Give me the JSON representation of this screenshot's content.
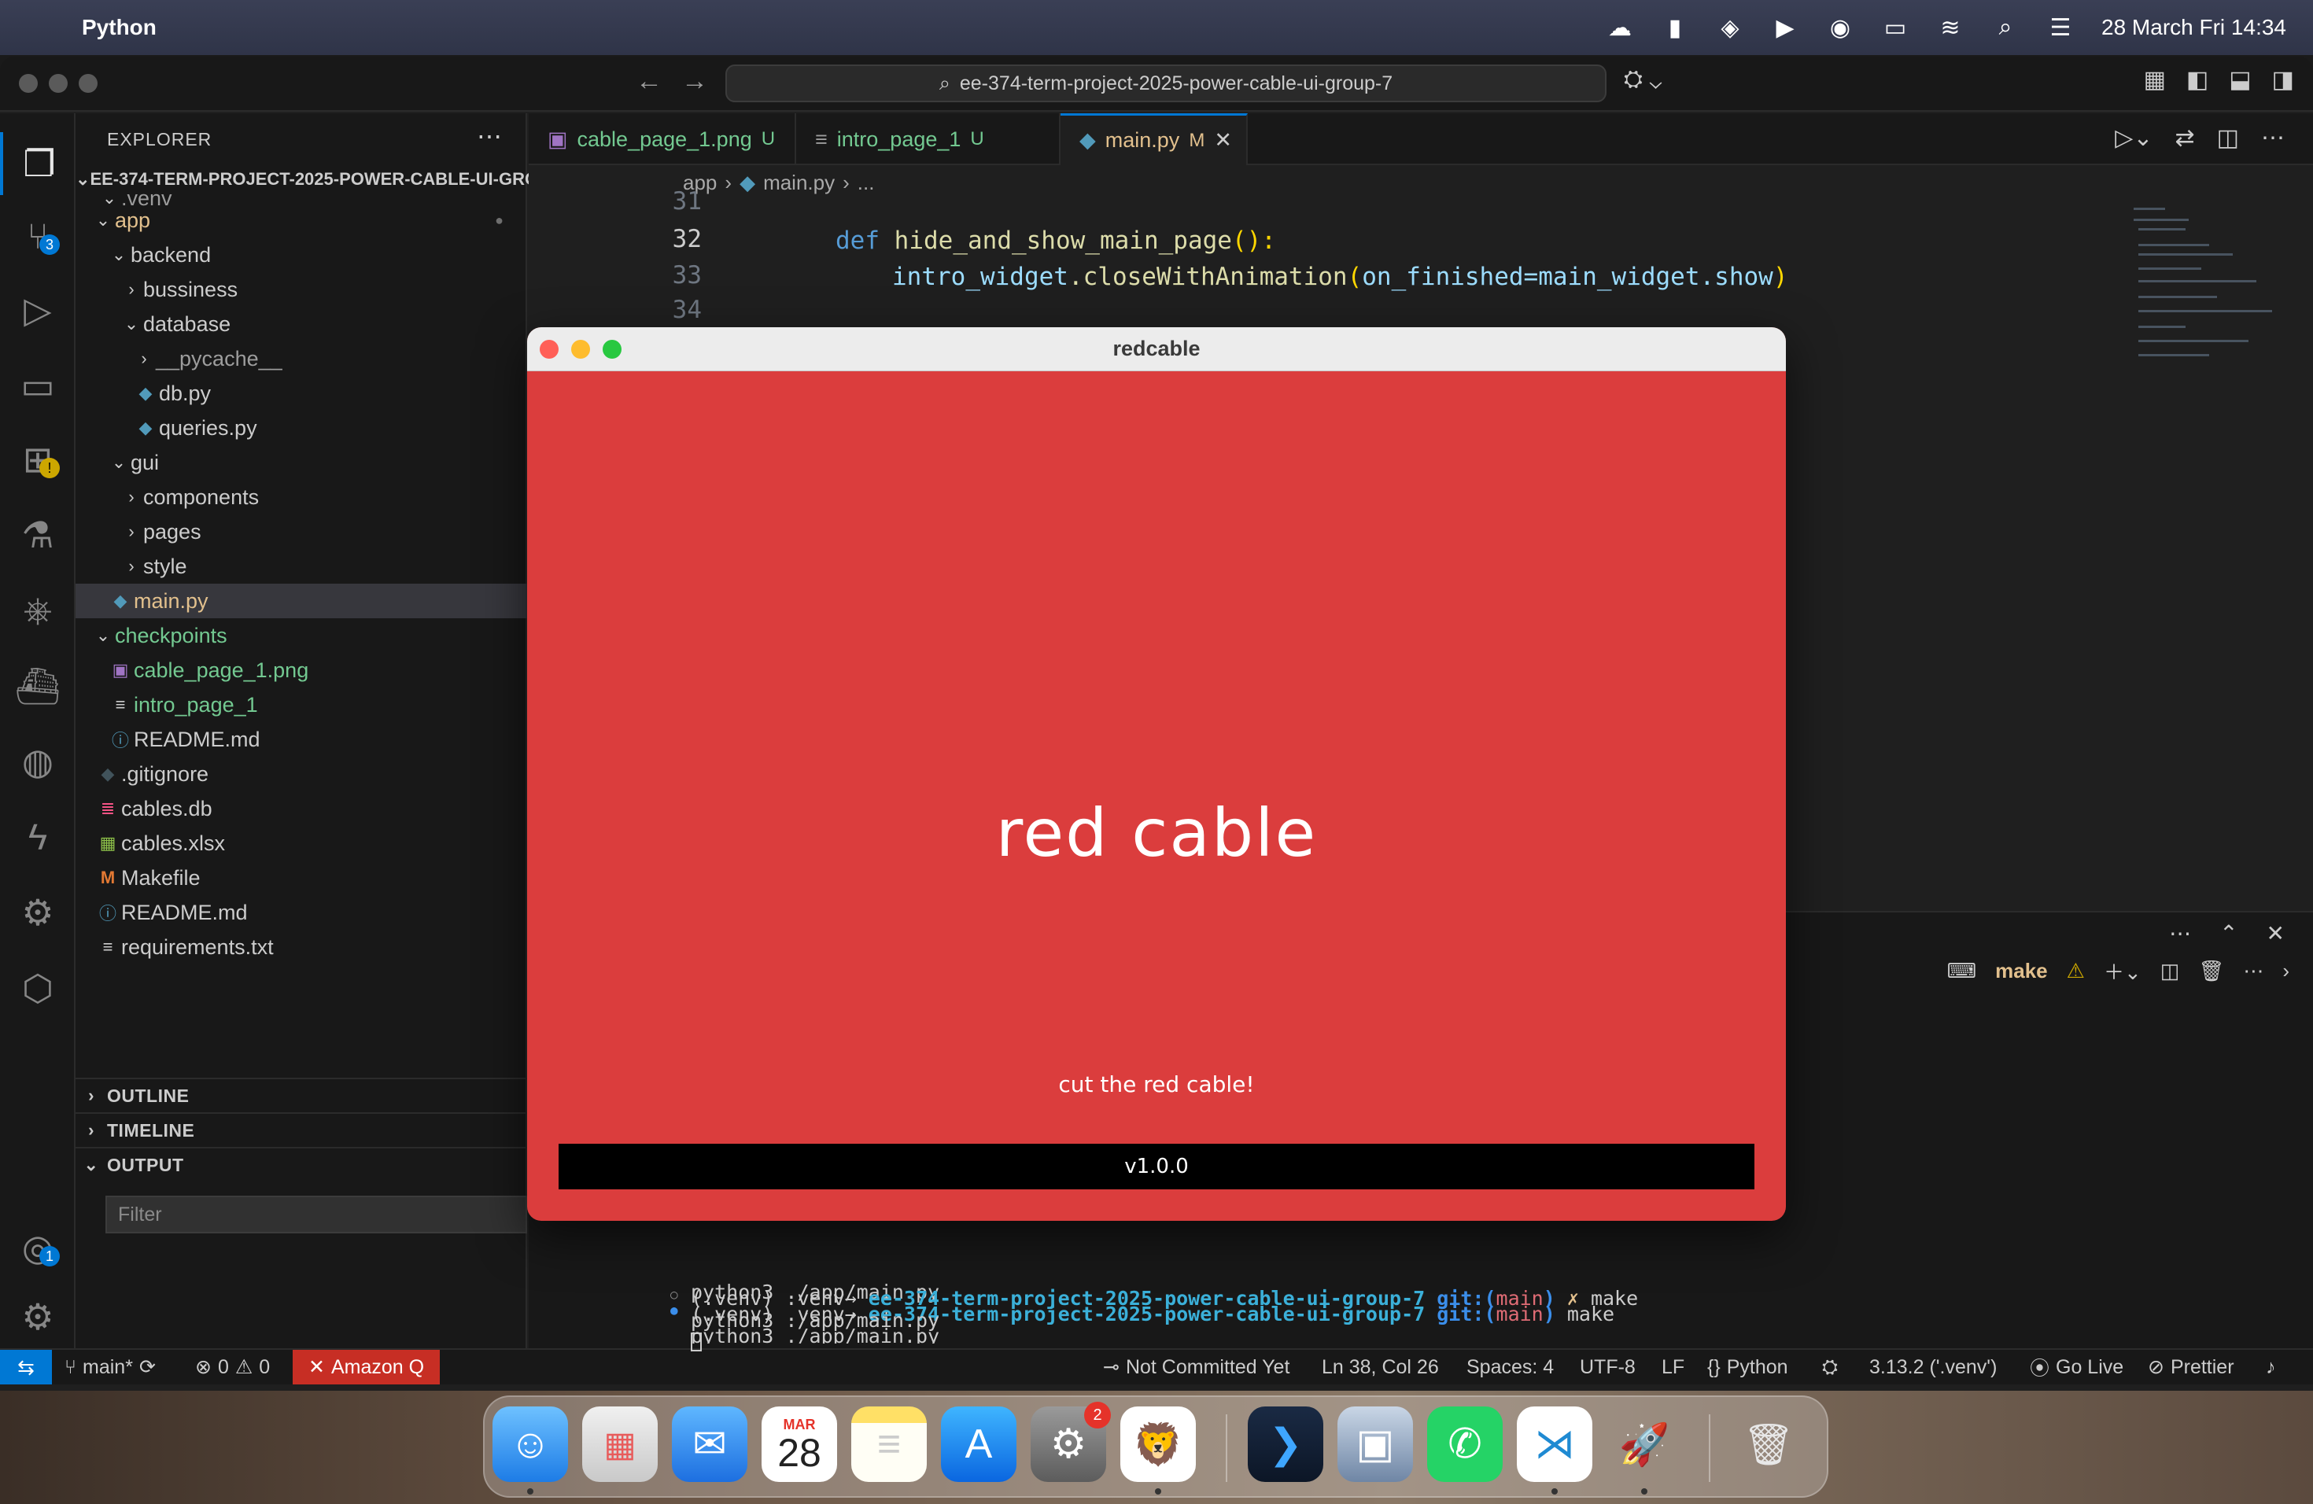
{
  "menubar": {
    "app_name": "Python",
    "datetime": "28 March Fri  14:34"
  },
  "titlebar": {
    "search_text": "ee-374-term-project-2025-power-cable-ui-group-7"
  },
  "activity": {
    "scm_badge": "3",
    "account_badge": "1"
  },
  "explorer": {
    "header": "EXPLORER",
    "root": "EE-374-TERM-PROJECT-2025-POWER-CABLE-UI-GROUP-7",
    "items": [
      {
        "label": ".venv"
      },
      {
        "label": "app"
      },
      {
        "label": "backend"
      },
      {
        "label": "bussiness"
      },
      {
        "label": "database"
      },
      {
        "label": "__pycache__"
      },
      {
        "label": "db.py"
      },
      {
        "label": "queries.py"
      },
      {
        "label": "gui"
      },
      {
        "label": "components"
      },
      {
        "label": "pages"
      },
      {
        "label": "style"
      },
      {
        "label": "main.py"
      },
      {
        "label": "checkpoints"
      },
      {
        "label": "cable_page_1.png"
      },
      {
        "label": "intro_page_1"
      },
      {
        "label": "README.md"
      },
      {
        "label": ".gitignore"
      },
      {
        "label": "cables.db"
      },
      {
        "label": "cables.xlsx"
      },
      {
        "label": "Makefile"
      },
      {
        "label": "README.md"
      },
      {
        "label": "requirements.txt"
      }
    ],
    "sections": {
      "outline": "OUTLINE",
      "timeline": "TIMELINE",
      "output": "OUTPUT"
    },
    "filter_placeholder": "Filter"
  },
  "tabs": [
    {
      "label": "cable_page_1.png",
      "status": "U"
    },
    {
      "label": "intro_page_1",
      "status": "U"
    },
    {
      "label": "main.py",
      "status": "M"
    }
  ],
  "breadcrumb": {
    "folder": "app",
    "file": "main.py",
    "more": "..."
  },
  "code": {
    "line_numbers": [
      "31",
      "32",
      "33",
      "34"
    ],
    "line32_kw": "def",
    "line32_fn": "hide_and_show_main_page",
    "line32_rest": "():",
    "line33_var": "intro_widget",
    "line33_call": ".closeWithAnimation",
    "line33_open": "(",
    "line33_arg": "on_finished=main_widget.show",
    "line33_close": ")"
  },
  "terminal": {
    "task_label": "make",
    "lines": [
      {
        "text": "python3 ./app/main.py"
      },
      {
        "prefix": "(.venv) .venv→ ",
        "dir": "ee-374-term-project-2025-power-cable-ui-group-7",
        "git": " git:(",
        "branch": "main",
        "close": ")",
        "cmd": " make"
      },
      {
        "text": "python3 ./app/main.py"
      },
      {
        "prefix": "(.venv) .venv→ ",
        "dir": "ee-374-term-project-2025-power-cable-ui-group-7",
        "git": " git:(",
        "branch": "main",
        "close": ")",
        "dirty": " ✗",
        "cmd": " make"
      },
      {
        "text": "python3 ./app/main.py"
      }
    ]
  },
  "statusbar": {
    "branch": "main*",
    "errors": "0",
    "warnings": "0",
    "amazon_q": "Amazon Q",
    "commit": "Not Committed Yet",
    "position": "Ln 38, Col 26",
    "spaces": "Spaces: 4",
    "encoding": "UTF-8",
    "eol": "LF",
    "language": "Python",
    "interpreter": "3.13.2 ('.venv')",
    "golive": "Go Live",
    "prettier": "Prettier"
  },
  "app_window": {
    "title": "redcable",
    "heading": "red cable",
    "subtitle": "cut the red cable!",
    "version": "v1.0.0",
    "colors": {
      "background": "#db3d3d",
      "version_bar": "#000000"
    }
  },
  "dock": {
    "calendar_month": "MAR",
    "calendar_day": "28",
    "settings_badge": "2"
  }
}
